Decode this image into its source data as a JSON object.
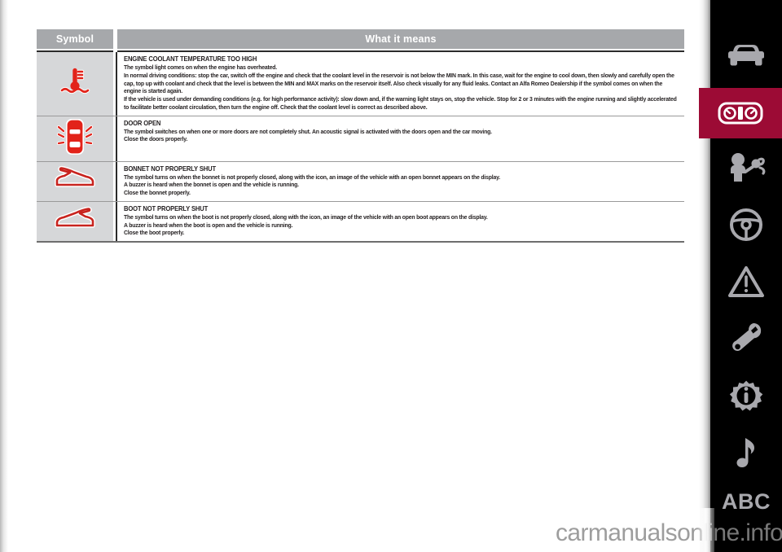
{
  "table": {
    "headers": {
      "symbol": "Symbol",
      "meaning": "What it means"
    },
    "rows": [
      {
        "icon_name": "engine-coolant-temperature-icon",
        "title": "ENGINE COOLANT TEMPERATURE TOO HIGH",
        "paragraphs": [
          "The symbol light comes on when the engine has overheated.",
          "In normal driving conditions: stop the car, switch off the engine and check that the coolant level in the reservoir is not below the MIN mark. In this case, wait for the engine to cool down, then slowly and carefully open the cap, top up with coolant and check that the level is between the MIN and MAX marks on the reservoir itself. Also check visually for any fluid leaks. Contact an Alfa Romeo Dealership if the symbol comes on when the engine is started again.",
          "If the vehicle is used under demanding conditions (e.g. for high performance activity): slow down and, if the warning light stays on, stop the vehicle. Stop for 2 or 3 minutes with the engine running and slightly accelerated to facilitate better coolant circulation, then turn the engine off. Check that the coolant level is correct as described above."
        ]
      },
      {
        "icon_name": "door-open-icon",
        "title": "DOOR OPEN",
        "paragraphs": [
          "The symbol switches on when one or more doors are not completely shut. An acoustic signal is activated with the doors open and the car moving.",
          "Close the doors properly."
        ]
      },
      {
        "icon_name": "bonnet-not-shut-icon",
        "title": "BONNET NOT PROPERLY SHUT",
        "paragraphs": [
          "The symbol turns on when the bonnet is not properly closed, along with the icon, an image of the vehicle with an open bonnet appears on the display.",
          "A buzzer is heard when the bonnet is open and the vehicle is running.",
          "Close the bonnet properly."
        ]
      },
      {
        "icon_name": "boot-not-shut-icon",
        "title": "BOOT NOT PROPERLY SHUT",
        "paragraphs": [
          "The symbol turns on when the boot is not properly closed, along with the icon, an image of the vehicle with an open boot appears on the display.",
          "A buzzer is heard when the boot is open and the vehicle is running.",
          "Close the boot properly."
        ]
      }
    ]
  },
  "sidebar": {
    "items": [
      {
        "icon_name": "car-front-icon",
        "label": "",
        "active": false
      },
      {
        "icon_name": "instrument-cluster-icon",
        "label": "",
        "active": true
      },
      {
        "icon_name": "airbag-safety-icon",
        "label": "",
        "active": false
      },
      {
        "icon_name": "steering-wheel-icon",
        "label": "",
        "active": false
      },
      {
        "icon_name": "warning-triangle-icon",
        "label": "",
        "active": false
      },
      {
        "icon_name": "wrench-icon",
        "label": "",
        "active": false
      },
      {
        "icon_name": "gear-info-icon",
        "label": "",
        "active": false
      },
      {
        "icon_name": "music-note-icon",
        "label": "",
        "active": false
      },
      {
        "icon_name": "alphabet-index-label",
        "label": "ABC",
        "active": false
      }
    ],
    "active_color": "#9c0b35"
  },
  "watermark": {
    "text": "carmanualsonline.info"
  },
  "colors": {
    "header_grey": "#a6a8ab",
    "symbol_cell_grey": "#d6d7d9",
    "icon_red": "#e2231a",
    "icon_red_outline": "#c8241f",
    "text_black": "#231f20",
    "accent": "#9c0b35"
  }
}
